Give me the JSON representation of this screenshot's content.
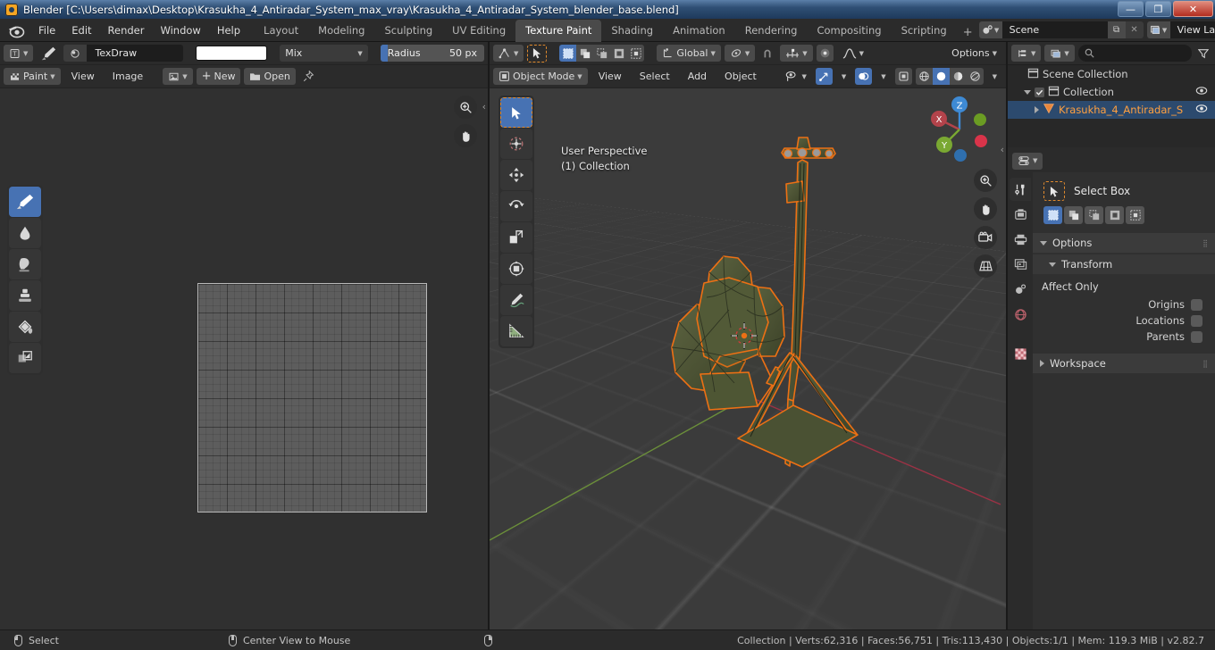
{
  "window": {
    "title": "Blender [C:\\Users\\dimax\\Desktop\\Krasukha_4_Antiradar_System_max_vray\\Krasukha_4_Antiradar_System_blender_base.blend]",
    "minimize": "—",
    "restore": "❐",
    "close": "✕"
  },
  "topbar": {
    "logo_name": "blender-logo",
    "menus": [
      "File",
      "Edit",
      "Render",
      "Window",
      "Help"
    ],
    "workspaces": [
      {
        "label": "Layout",
        "active": false
      },
      {
        "label": "Modeling",
        "active": false
      },
      {
        "label": "Sculpting",
        "active": false
      },
      {
        "label": "UV Editing",
        "active": false
      },
      {
        "label": "Texture Paint",
        "active": true
      },
      {
        "label": "Shading",
        "active": false
      },
      {
        "label": "Animation",
        "active": false
      },
      {
        "label": "Rendering",
        "active": false
      },
      {
        "label": "Compositing",
        "active": false
      },
      {
        "label": "Scripting",
        "active": false
      }
    ],
    "add_workspace": "+",
    "scene": {
      "name": "Scene",
      "new_btn": "⧉",
      "unlink_btn": "✕"
    },
    "view_layer": {
      "name": "View Layer",
      "new_btn": "⧉",
      "unlink_btn": "✕"
    }
  },
  "image_editor": {
    "header_top": {
      "editor_type": "image-editor",
      "brush_icon": "brush-icon",
      "brush_data_icon": "brush-data-icon",
      "brush_name": "TexDraw",
      "color_swatch": "#ffffff",
      "blend_mode": "Mix",
      "radius_label": "Radius",
      "radius_value": "50 px",
      "radius_fill_pct": 7
    },
    "header_bottom": {
      "mode": "Paint",
      "menus": [
        "View",
        "Image"
      ],
      "image_dd": "image-datablock",
      "new_label": "New",
      "open_label": "Open",
      "pin_icon": "pin-icon"
    },
    "tools": [
      {
        "name": "draw-brush-tool",
        "active": true
      },
      {
        "name": "soften-tool",
        "active": false
      },
      {
        "name": "smear-tool",
        "active": false
      },
      {
        "name": "clone-tool",
        "active": false
      },
      {
        "name": "fill-tool",
        "active": false
      },
      {
        "name": "mask-tool",
        "active": false
      }
    ],
    "gizmos": [
      {
        "name": "zoom-gizmo",
        "glyph": "⊕"
      },
      {
        "name": "pan-gizmo",
        "glyph": "✋"
      }
    ]
  },
  "viewport": {
    "header_top": {
      "editor_type": "3d-viewport",
      "cursor_tool": "select-box-active",
      "select_modes": [
        "set",
        "extend",
        "subtract",
        "invert",
        "intersect"
      ],
      "transform_orientation": "Global",
      "pivot_icon": "pivot-point-icon",
      "snap_magnet": "snap-magnet-icon",
      "snap_to": "snap-increment-icon",
      "proportional_edit": "proportional-edit-icon",
      "falloff": "falloff-icon",
      "options_label": "Options"
    },
    "header_bottom": {
      "mode": "Object Mode",
      "menus": [
        "View",
        "Select",
        "Add",
        "Object"
      ],
      "visibility_icon": "visibility-icon",
      "gizmo_icon": "gizmo-icon",
      "overlays_icon": "overlays-icon",
      "xray_icon": "xray-icon",
      "shading_modes": [
        "wireframe",
        "solid",
        "material-preview",
        "rendered"
      ],
      "shading_active": "solid"
    },
    "overlay_text_line1": "User Perspective",
    "overlay_text_line2": "(1) Collection",
    "axis_gizmo": {
      "x": "X",
      "y": "Y",
      "z": "Z"
    },
    "nav_gizmos": [
      {
        "name": "zoom-gizmo",
        "glyph": "⊕"
      },
      {
        "name": "pan-gizmo",
        "glyph": "✋"
      },
      {
        "name": "camera-view-gizmo",
        "glyph": "▣"
      },
      {
        "name": "toggle-perspective-gizmo",
        "glyph": "▦"
      }
    ],
    "tools": [
      {
        "name": "tweak-select-tool",
        "active": true
      },
      {
        "name": "cursor-tool",
        "active": false
      },
      {
        "name": "move-tool",
        "active": false
      },
      {
        "name": "rotate-tool",
        "active": false
      },
      {
        "name": "scale-tool",
        "active": false
      },
      {
        "name": "transform-tool",
        "active": false
      },
      {
        "name": "annotate-tool",
        "active": false
      },
      {
        "name": "measure-tool",
        "active": false
      }
    ],
    "object": {
      "name": "Krasukha_4_Antiradar_System",
      "selected": true,
      "outline_color": "#ed7014",
      "body_color": "#4c5233"
    }
  },
  "outliner": {
    "display_mode": "view-layer",
    "filter_icon": "filter-icon",
    "search_placeholder": "",
    "rows": [
      {
        "label": "Scene Collection",
        "indent": 0,
        "icon": "collection-icon",
        "selected": false,
        "eye": false,
        "checkbox": false,
        "disclosure": "none"
      },
      {
        "label": "Collection",
        "indent": 1,
        "icon": "collection-icon",
        "selected": false,
        "eye": true,
        "checkbox": true,
        "disclosure": "down"
      },
      {
        "label": "Krasukha_4_Antiradar_S",
        "indent": 2,
        "icon": "mesh-object-icon",
        "selected": true,
        "eye": true,
        "checkbox": false,
        "disclosure": "right",
        "highlight": true
      }
    ]
  },
  "properties": {
    "editor_icon": "properties-editor-icon",
    "tabs": [
      {
        "name": "tool-tab",
        "active": true
      },
      {
        "name": "render-tab",
        "active": false
      },
      {
        "name": "output-tab",
        "active": false
      },
      {
        "name": "view-layer-tab",
        "active": false
      },
      {
        "name": "scene-tab",
        "active": false
      },
      {
        "name": "world-tab",
        "active": false
      },
      {
        "name": "texture-tab",
        "active": false
      }
    ],
    "active_tool": {
      "icon": "select-box-icon",
      "name": "Select Box",
      "modes": [
        "set",
        "extend",
        "subtract",
        "invert",
        "intersect"
      ],
      "active_mode": "set"
    },
    "panels": [
      {
        "label": "Options",
        "expanded": true
      },
      {
        "label": "Transform",
        "expanded": true,
        "sub": true
      }
    ],
    "affect_only_label": "Affect Only",
    "affect_only": [
      {
        "label": "Origins",
        "checked": false
      },
      {
        "label": "Locations",
        "checked": false
      },
      {
        "label": "Parents",
        "checked": false
      }
    ],
    "workspace_panel": {
      "label": "Workspace",
      "expanded": false
    }
  },
  "statusbar": {
    "keymap": [
      {
        "icon": "mouse-left-icon",
        "label": "Select"
      },
      {
        "icon": "mouse-middle-icon",
        "label": "Center View to Mouse"
      },
      {
        "icon": "mouse-right-icon",
        "label": ""
      }
    ],
    "stats": "Collection | Verts:62,316 | Faces:56,751 | Tris:113,430 | Objects:1/1 | Mem: 119.3 MiB | v2.82.7"
  }
}
